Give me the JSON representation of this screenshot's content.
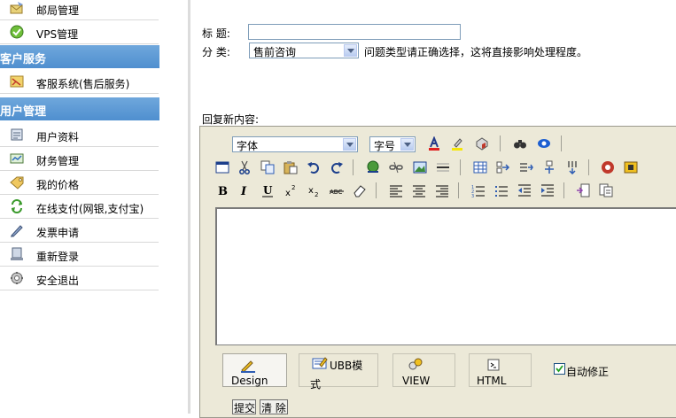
{
  "sidebar": {
    "items_top": [
      {
        "label": "邮局管理",
        "icon": "mail-icon"
      },
      {
        "label": "VPS管理",
        "icon": "vps-icon"
      }
    ],
    "section_service": {
      "title": "客户服务"
    },
    "service_items": [
      {
        "label": "客服系统(售后服务)",
        "icon": "support-icon"
      }
    ],
    "section_user": {
      "title": "用户管理"
    },
    "user_items": [
      {
        "label": "用户资料",
        "icon": "profile-icon"
      },
      {
        "label": "财务管理",
        "icon": "finance-icon"
      },
      {
        "label": "我的价格",
        "icon": "price-icon"
      },
      {
        "label": "在线支付(网银,支付宝)",
        "icon": "online-pay-icon"
      },
      {
        "label": "发票申请",
        "icon": "invoice-icon"
      },
      {
        "label": "重新登录",
        "icon": "relogin-icon"
      },
      {
        "label": "安全退出",
        "icon": "logout-icon"
      }
    ]
  },
  "form": {
    "title_label": "标  题:",
    "title_value": "",
    "category_label": "分  类:",
    "category_selected": "售前咨询",
    "category_hint": "问题类型请正确选择，这将直接影响处理程度。",
    "reply_label": "回复新内容:"
  },
  "editor": {
    "font_select": "字体",
    "size_select": "字号",
    "format_buttons": [
      "B",
      "I",
      "U"
    ],
    "modes": [
      {
        "label": "Design",
        "icon": "design-icon",
        "active": true
      },
      {
        "label": "UBB模式",
        "icon": "ubb-icon",
        "active": false
      },
      {
        "label": "VIEW",
        "icon": "view-icon",
        "active": false
      },
      {
        "label": "HTML",
        "icon": "html-icon",
        "active": false
      }
    ],
    "autofix_label": "自动修正",
    "autofix_checked": true
  },
  "buttons": {
    "submit": "提交",
    "clear": "清 除"
  },
  "colors": {
    "sidebar_header": "#5b9bd5",
    "editor_bg": "#ece9d8",
    "input_border": "#7f9db9"
  }
}
